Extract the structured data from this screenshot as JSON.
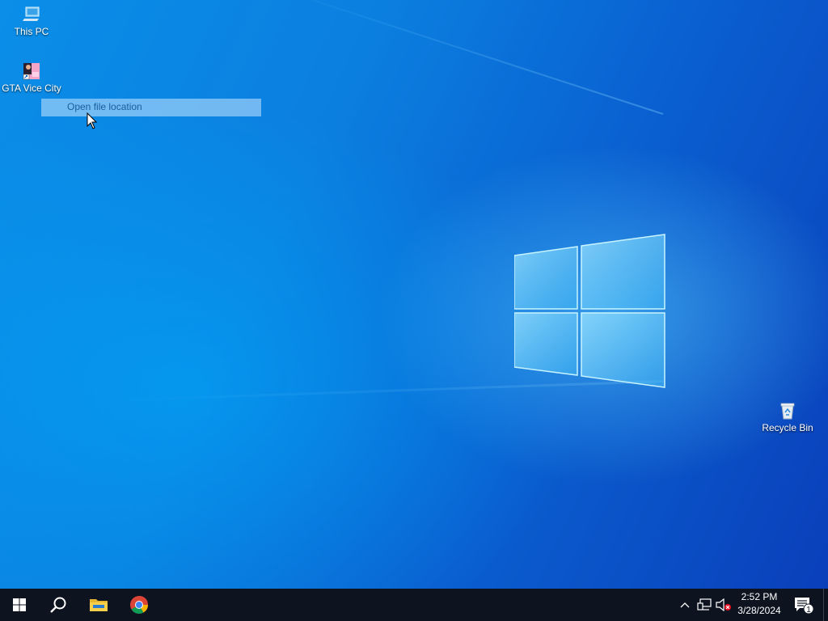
{
  "desktop": {
    "icons": [
      {
        "label": "This PC",
        "icon": "computer-icon"
      },
      {
        "label": "GTA Vice City",
        "icon": "game-shortcut-icon"
      },
      {
        "label": "Recycle Bin",
        "icon": "recycle-bin-icon"
      }
    ]
  },
  "context_menu": {
    "item_label": "Open file location"
  },
  "taskbar": {
    "start": "windows-logo-icon",
    "search": "search-icon",
    "pinned": [
      {
        "name": "File Explorer",
        "icon": "folder-icon"
      },
      {
        "name": "Google Chrome",
        "icon": "chrome-icon"
      }
    ],
    "tray": {
      "overflow": "chevron-up-icon",
      "network": "network-icon",
      "volume": "volume-muted-icon"
    },
    "clock": {
      "time": "2:52 PM",
      "date": "3/28/2024"
    },
    "notifications": {
      "icon": "action-center-icon",
      "count": "1"
    }
  },
  "colors": {
    "taskbar_bg": "#0d1420",
    "desktop_blue": "#0b7fe0",
    "highlight": "#c8e6ff"
  }
}
